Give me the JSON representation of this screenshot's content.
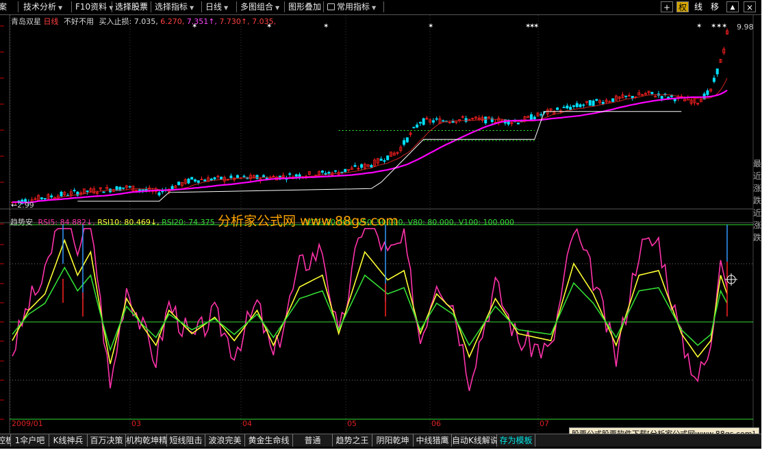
{
  "toolbar": {
    "items": [
      {
        "label": "案",
        "arrow": false
      },
      {
        "label": "技术分析",
        "arrow": true
      },
      {
        "label": "F10资料",
        "arrow": true
      },
      {
        "label": "选择股票",
        "arrow": false
      },
      {
        "label": "选择指标",
        "arrow": true
      },
      {
        "label": "日线",
        "arrow": true
      },
      {
        "label": "多图组合",
        "arrow": true
      },
      {
        "label": "图形叠加",
        "arrow": false
      },
      {
        "label": "常用指标",
        "arrow": true
      }
    ],
    "right": {
      "plus": "+",
      "quan": "权",
      "xian": "线",
      "yi": "移",
      "up": "▲",
      "close": "×"
    }
  },
  "header": {
    "stock_name": "青岛双星",
    "period": "日线",
    "note": "不好不用",
    "label": "买入止损:",
    "v1": "7.035,",
    "v2": "6.270,",
    "v3": "7.351↑,",
    "v4": "7.730↑,",
    "v5": "7.035,"
  },
  "price_labels": {
    "high": "9.98",
    "low": "2.99"
  },
  "indicator": {
    "name": "趋势安",
    "rsi5": "RSI5: 84.882↓,",
    "rsi10": "RSI10: 80.469↓,",
    "rsi20": "RSI20: 74.375",
    "tail": "V20: 20.000, V50: 50.000, V80: 80.000, V100: 100.000"
  },
  "watermark": "分析家公式网 www.88gs.com",
  "axis_months": [
    "2009/01",
    "03",
    "04",
    "05",
    "06",
    "07"
  ],
  "bottom_tabs": [
    "控板",
    "1伞户吧",
    "K线神兵",
    "百万决策",
    "机构乾坤精",
    "短线阻击",
    "波浪完美",
    "黄金生命线",
    "普通",
    "趋势之王",
    "阴阳乾坤",
    "中线猎鹰",
    "自动K线解说",
    "存为模板"
  ],
  "ad_text": "股票公式股票软件下载[分析家公式网www.88gs.com]",
  "right_sidebar": "最近涨跌近涨跌",
  "colors": {
    "up": "#ff2020",
    "down": "#00e0ff",
    "ma_magenta": "#ff00ff",
    "rsi_fast": "#ff33aa",
    "rsi_mid": "#ffff33",
    "rsi_slow": "#33dd33",
    "accent": "#d4a500"
  },
  "chart_data": {
    "type": "candlestick",
    "price_range": [
      2.99,
      9.98
    ],
    "indicator_type": "line",
    "indicator_lines": [
      "RSI5",
      "RSI10",
      "RSI20"
    ],
    "levels": [
      20,
      50,
      80,
      100
    ]
  }
}
